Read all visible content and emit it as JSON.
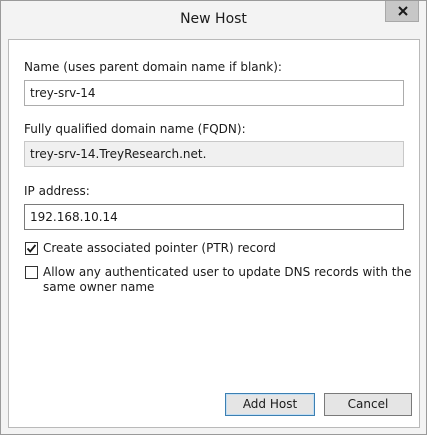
{
  "window": {
    "title": "New Host"
  },
  "title_bar": {
    "close_icon": "close-icon"
  },
  "form": {
    "name_label": "Name (uses parent domain name if blank):",
    "name_value": "trey-srv-14",
    "fqdn_label": "Fully qualified domain name (FQDN):",
    "fqdn_value": "trey-srv-14.TreyResearch.net.",
    "ip_label": "IP address:",
    "ip_value": "192.168.10.14",
    "ptr_checkbox": {
      "label": "Create associated pointer (PTR) record",
      "checked": true
    },
    "allow_update_checkbox": {
      "label_line1": "Allow any authenticated user to update DNS records with the",
      "label_line2": "same owner name",
      "checked": false
    }
  },
  "buttons": {
    "add_host": "Add Host",
    "cancel": "Cancel"
  }
}
